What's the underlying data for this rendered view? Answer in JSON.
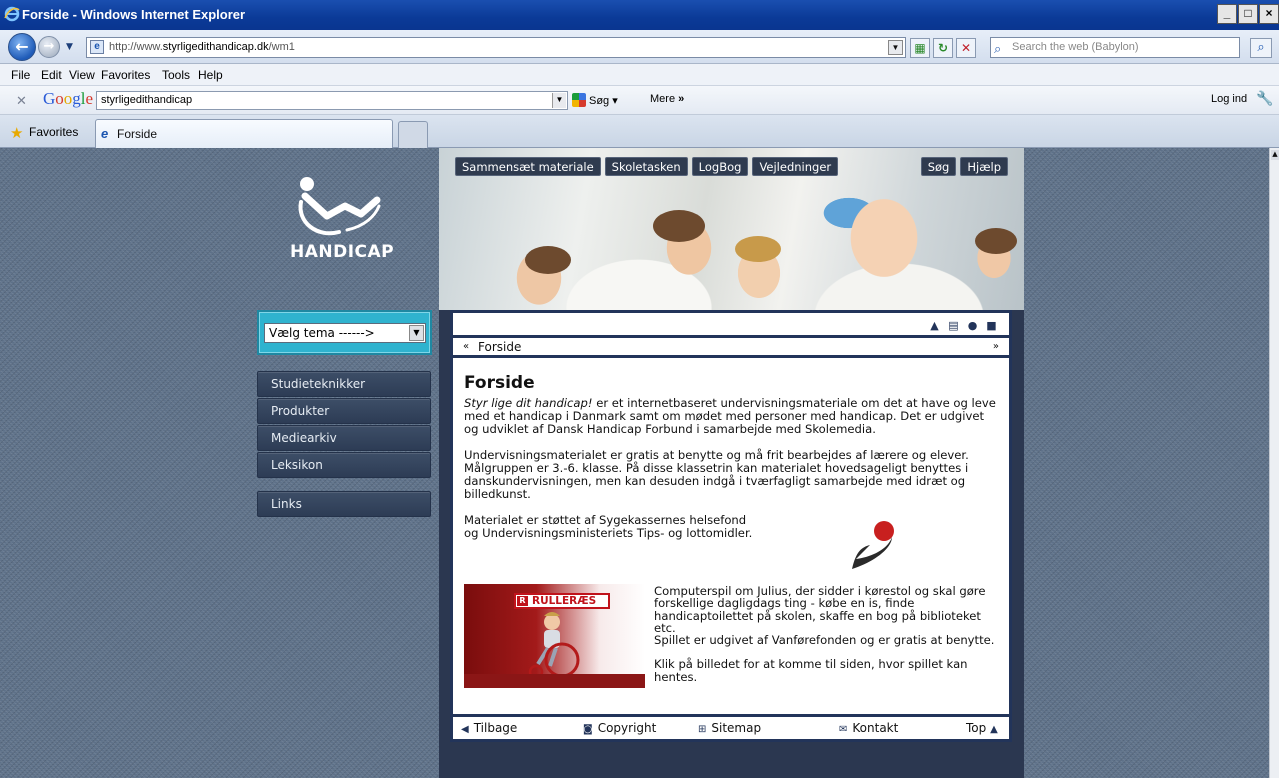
{
  "window": {
    "title": "Forside - Windows Internet Explorer",
    "buttons": [
      "_",
      "□",
      "×"
    ]
  },
  "address": {
    "url_prefix": "http://www.",
    "url_domain": "styrligedithandicap.dk",
    "url_path": "/wm1",
    "search_placeholder": "Search the web (Babylon)"
  },
  "menu": [
    "File",
    "Edit",
    "View",
    "Favorites",
    "Tools",
    "Help"
  ],
  "google_bar": {
    "logo": [
      "G",
      "o",
      "o",
      "g",
      "l",
      "e"
    ],
    "query": "styrligedithandicap",
    "search_label": "Søg",
    "more_label": "Mere",
    "login_label": "Log ind"
  },
  "tabs": {
    "favorites_label": "Favorites",
    "active_tab": "Forside"
  },
  "site": {
    "logo_word": "HANDICAP",
    "theme_select": "Vælg tema ------>",
    "nav": [
      "Studieteknikker",
      "Produkter",
      "Mediearkiv",
      "Leksikon"
    ],
    "nav_extra": [
      "Links"
    ],
    "top_menu": [
      "Sammensæt materiale",
      "Skoletasken",
      "LogBog",
      "Vejledninger"
    ],
    "top_right": [
      "Søg",
      "Hjælp"
    ],
    "breadcrumb": "Forside",
    "article": {
      "title": "Forside",
      "p1_em": "Styr lige dit handicap!",
      "p1_rest": " er et internetbaseret undervisningsmateriale om det at have og leve med et handicap i Danmark samt om mødet med personer med handicap. Det er udgivet og udviklet af Dansk Handicap Forbund i samarbejde med Skolemedia.",
      "p2": "Undervisningsmaterialet er gratis at benytte og må frit bearbejdes af lærere og elever. Målgruppen er 3.-6. klasse. På disse klassetrin kan materialet hovedsageligt benyttes i danskundervisningen, men kan desuden indgå i tværfagligt samarbejde med idræt og billedkunst.",
      "p3": "Materialet er støttet af Sygekassernes helsefond og Undervisningsministeriets Tips- og lottomidler.",
      "game_banner": "RULLERÆS",
      "game_p1": "Computerspil om Julius, der sidder i kørestol og skal gøre forskellige dagligdags ting - købe en is, finde handicaptoilettet på skolen, skaffe en bog på biblioteket etc.",
      "game_p1b": "Spillet er udgivet af Vanførefonden og er gratis at benytte.",
      "game_p2": "Klik på billedet for at komme til siden, hvor spillet kan hentes."
    },
    "footer": {
      "back": "Tilbage",
      "copyright": "Copyright",
      "sitemap": "Sitemap",
      "contact": "Kontakt",
      "top": "Top"
    }
  },
  "colors": {
    "nav_bg": "#34445d",
    "accent_cyan": "#2fb3cf",
    "frame_navy": "#22345a",
    "ie_title": "#0b3a97"
  }
}
